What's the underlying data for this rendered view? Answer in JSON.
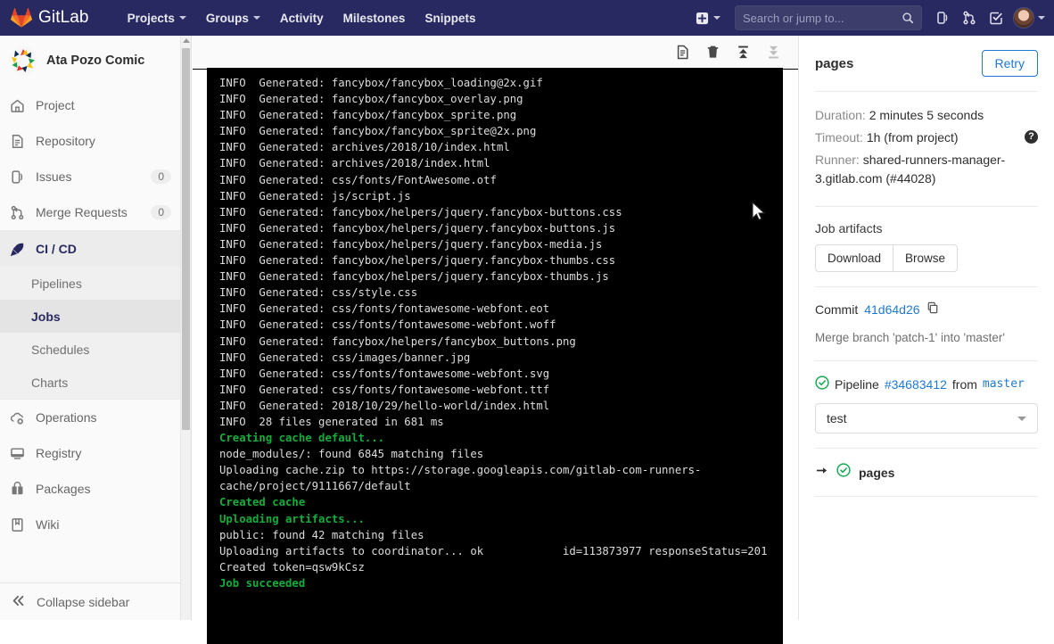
{
  "topnav": {
    "wordmark": "GitLab",
    "logo_icon": "gitlab-tanuki-icon",
    "links": [
      {
        "label": "Projects",
        "has_caret": true
      },
      {
        "label": "Groups",
        "has_caret": true
      },
      {
        "label": "Activity",
        "has_caret": false
      },
      {
        "label": "Milestones",
        "has_caret": false
      },
      {
        "label": "Snippets",
        "has_caret": false
      }
    ],
    "plus_icon": "plus-square-icon",
    "search": {
      "placeholder": "Search or jump to...",
      "value": "",
      "icon": "search-icon"
    },
    "icons": [
      {
        "name": "issues-icon"
      },
      {
        "name": "merge-request-icon"
      },
      {
        "name": "todos-done-icon"
      }
    ],
    "avatar_icon": "user-avatar",
    "bg_color": "#292961"
  },
  "sidebar": {
    "project_name": "Ata Pozo Comic",
    "project_avatar_icon": "project-pinwheel-avatar",
    "items": [
      {
        "label": "Project",
        "icon": "home-icon",
        "count": ""
      },
      {
        "label": "Repository",
        "icon": "document-icon",
        "count": ""
      },
      {
        "label": "Issues",
        "icon": "issues-icon",
        "count": "0"
      },
      {
        "label": "Merge Requests",
        "icon": "merge-request-icon",
        "count": "0"
      },
      {
        "label": "CI / CD",
        "icon": "rocket-icon",
        "count": "",
        "active": true
      }
    ],
    "cicd_subitems": [
      {
        "label": "Pipelines",
        "active": false
      },
      {
        "label": "Jobs",
        "active": true
      },
      {
        "label": "Schedules",
        "active": false
      },
      {
        "label": "Charts",
        "active": false
      }
    ],
    "items_bottom": [
      {
        "label": "Operations",
        "icon": "cloud-gear-icon"
      },
      {
        "label": "Registry",
        "icon": "monitor-icon"
      },
      {
        "label": "Packages",
        "icon": "package-icon"
      },
      {
        "label": "Wiki",
        "icon": "book-icon"
      }
    ],
    "collapse": {
      "label": "Collapse sidebar",
      "icon": "chevron-double-left-icon"
    }
  },
  "log": {
    "toolbar_icons": [
      {
        "name": "raw-log-icon",
        "enabled": true
      },
      {
        "name": "erase-log-icon",
        "enabled": true
      },
      {
        "name": "scroll-to-top-icon",
        "enabled": true
      },
      {
        "name": "scroll-to-bottom-icon",
        "enabled": false
      }
    ],
    "lines": [
      {
        "text": "INFO  Generated: fancybox/fancybox_loading@2x.gif",
        "style": "plain"
      },
      {
        "text": "INFO  Generated: fancybox/fancybox_overlay.png",
        "style": "plain"
      },
      {
        "text": "INFO  Generated: fancybox/fancybox_sprite.png",
        "style": "plain"
      },
      {
        "text": "INFO  Generated: fancybox/fancybox_sprite@2x.png",
        "style": "plain"
      },
      {
        "text": "INFO  Generated: archives/2018/10/index.html",
        "style": "plain"
      },
      {
        "text": "INFO  Generated: archives/2018/index.html",
        "style": "plain"
      },
      {
        "text": "INFO  Generated: css/fonts/FontAwesome.otf",
        "style": "plain"
      },
      {
        "text": "INFO  Generated: js/script.js",
        "style": "plain"
      },
      {
        "text": "INFO  Generated: fancybox/helpers/jquery.fancybox-buttons.css",
        "style": "plain"
      },
      {
        "text": "INFO  Generated: fancybox/helpers/jquery.fancybox-buttons.js",
        "style": "plain"
      },
      {
        "text": "INFO  Generated: fancybox/helpers/jquery.fancybox-media.js",
        "style": "plain"
      },
      {
        "text": "INFO  Generated: fancybox/helpers/jquery.fancybox-thumbs.css",
        "style": "plain"
      },
      {
        "text": "INFO  Generated: fancybox/helpers/jquery.fancybox-thumbs.js",
        "style": "plain"
      },
      {
        "text": "INFO  Generated: css/style.css",
        "style": "plain"
      },
      {
        "text": "INFO  Generated: css/fonts/fontawesome-webfont.eot",
        "style": "plain"
      },
      {
        "text": "INFO  Generated: css/fonts/fontawesome-webfont.woff",
        "style": "plain"
      },
      {
        "text": "INFO  Generated: fancybox/helpers/fancybox_buttons.png",
        "style": "plain"
      },
      {
        "text": "INFO  Generated: css/images/banner.jpg",
        "style": "plain"
      },
      {
        "text": "INFO  Generated: css/fonts/fontawesome-webfont.svg",
        "style": "plain"
      },
      {
        "text": "INFO  Generated: css/fonts/fontawesome-webfont.ttf",
        "style": "plain"
      },
      {
        "text": "INFO  Generated: 2018/10/29/hello-world/index.html",
        "style": "plain"
      },
      {
        "text": "INFO  28 files generated in 681 ms",
        "style": "plain"
      },
      {
        "text": "Creating cache default...",
        "style": "green"
      },
      {
        "text": "node_modules/: found 6845 matching files",
        "style": "plain"
      },
      {
        "text": "Uploading cache.zip to https://storage.googleapis.com/gitlab-com-runners-cache/project/9111667/default",
        "style": "plain"
      },
      {
        "text": "Created cache",
        "style": "green"
      },
      {
        "text": "Uploading artifacts...",
        "style": "green"
      },
      {
        "text": "public: found 42 matching files",
        "style": "plain"
      },
      {
        "text": "Uploading artifacts to coordinator... ok            id=113873977 responseStatus=201",
        "style": "plain"
      },
      {
        "text": "Created token=qsw9kCsz",
        "style": "plain"
      },
      {
        "text": "Job succeeded",
        "style": "green"
      }
    ],
    "bg_color": "#000000",
    "green_color": "#13ad3b"
  },
  "right_panel": {
    "job_name": "pages",
    "retry_label": "Retry",
    "duration_label": "Duration:",
    "duration_value": "2 minutes 5 seconds",
    "timeout_label": "Timeout:",
    "timeout_value": "1h (from project)",
    "timeout_help_icon": "question-mark-icon",
    "runner_label": "Runner:",
    "runner_value": "shared-runners-manager-3.gitlab.com (#44028)",
    "artifacts_title": "Job artifacts",
    "download_label": "Download",
    "browse_label": "Browse",
    "commit_label": "Commit",
    "commit_sha": "41d64d26",
    "copy_icon": "copy-icon",
    "commit_message": "Merge branch 'patch-1' into 'master'",
    "pipeline_status_icon": "status-success-icon",
    "pipeline_label": "Pipeline",
    "pipeline_id": "#34683412",
    "pipeline_from": "from",
    "pipeline_ref": "master",
    "stage_select_value": "test",
    "stage_chevron_icon": "chevron-down-icon",
    "job_list": [
      {
        "arrow_icon": "arrow-right-icon",
        "status_icon": "status-success-icon",
        "name": "pages"
      }
    ],
    "link_color": "#1f78d1"
  }
}
